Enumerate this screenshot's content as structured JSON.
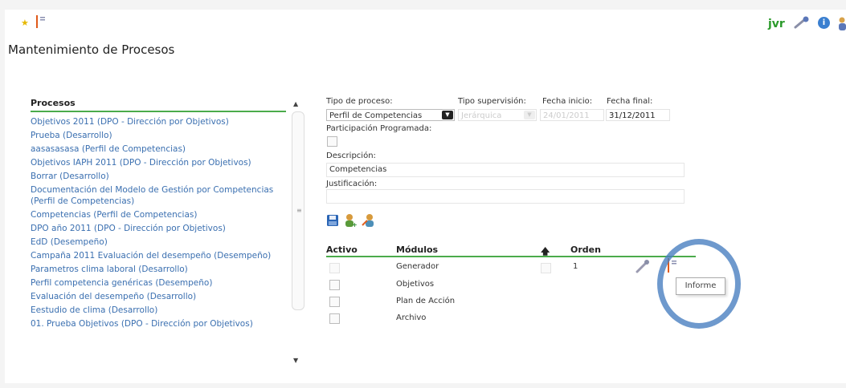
{
  "header": {
    "title": "Mantenimiento de Procesos",
    "user": "jvr",
    "info_glyph": "i"
  },
  "icons": {
    "favorite": "star-icon",
    "report": "report-icon",
    "settings": "wrench-icon",
    "info": "info-icon",
    "user": "person-icon"
  },
  "processes": {
    "header": "Procesos",
    "items": [
      "Objetivos 2011 (DPO - Dirección por Objetivos)",
      "Prueba (Desarrollo)",
      "aasasasasa (Perfil de Competencias)",
      "Objetivos IAPH 2011 (DPO - Dirección por Objetivos)",
      "Borrar (Desarrollo)",
      "Documentación del Modelo de Gestión por Competencias (Perfil de Competencias)",
      "Competencias (Perfil de Competencias)",
      "DPO año 2011 (DPO - Dirección por Objetivos)",
      "EdD (Desempeño)",
      "Campaña 2011 Evaluación del desempeño (Desempeño)",
      "Parametros clima laboral (Desarrollo)",
      "Perfil competencia genéricas (Desempeño)",
      "Evaluación del desempeño (Desarrollo)",
      "Eestudio de clima (Desarrollo)",
      "01. Prueba Objetivos (DPO - Dirección por Objetivos)"
    ]
  },
  "form": {
    "tipo_proceso_label": "Tipo de proceso:",
    "tipo_proceso_value": "Perfil de Competencias",
    "tipo_supervision_label": "Tipo supervisión:",
    "tipo_supervision_value": "Jerárquica",
    "fecha_inicio_label": "Fecha inicio:",
    "fecha_inicio_value": "24/01/2011",
    "fecha_final_label": "Fecha final:",
    "fecha_final_value": "31/12/2011",
    "participacion_label": "Participación Programada:",
    "descripcion_label": "Descripción:",
    "descripcion_value": "Competencias",
    "justificacion_label": "Justificación:",
    "justificacion_value": ""
  },
  "modules": {
    "col_activo": "Activo",
    "col_modulos": "Módulos",
    "col_orden": "Orden",
    "sort_glyph": "🡅",
    "rows": [
      {
        "name": "Generador",
        "orden": "1"
      },
      {
        "name": "Objetivos",
        "orden": ""
      },
      {
        "name": "Plan de Acción",
        "orden": ""
      },
      {
        "name": "Archivo",
        "orden": ""
      }
    ]
  },
  "tooltip": "Informe",
  "colors": {
    "accent_green": "#4bab4b",
    "link_blue": "#3a6fb0",
    "highlight_circle": "#4a7fc1"
  }
}
